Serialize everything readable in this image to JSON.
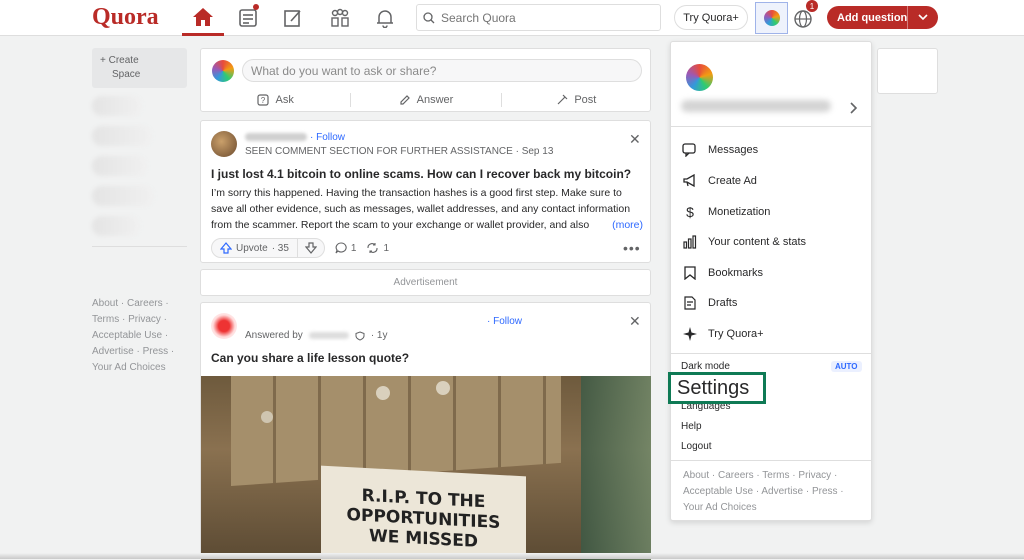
{
  "header": {
    "logo": "Quora",
    "search_placeholder": "Search Quora",
    "try_quora_plus": "Try Quora+",
    "notification_count": "1",
    "add_question": "Add question"
  },
  "sidebar": {
    "create_space_line1": "+ Create",
    "create_space_line2": "Space",
    "footer_lines": [
      "About · Careers ·",
      "Terms · Privacy ·",
      "Acceptable Use ·",
      "Advertise · Press ·",
      "Your Ad Choices"
    ]
  },
  "ask_box": {
    "placeholder": "What do you want to ask or share?",
    "ask": "Ask",
    "answer": "Answer",
    "post": "Post"
  },
  "post1": {
    "follow": "· Follow",
    "meta": "SEEN COMMENT SECTION FOR FURTHER ASSISTANCE · Sep 13",
    "title": "I just lost 4.1 bitcoin to online scams. How can I recover back my bitcoin?",
    "body_lines": [
      "I’m sorry this happened. Having the transaction hashes is a good first step. Make sure to",
      "save all other evidence, such as messages, wallet addresses, and any contact information",
      "from the scammer. Report the scam to your exchange or wallet provider, and also"
    ],
    "more": "(more)",
    "upvote": "Upvote",
    "upvote_count": "· 35",
    "comments": "1",
    "shares": "1"
  },
  "advertisement": "Advertisement",
  "post2": {
    "answered_by": "Answered by",
    "time": "· 1y",
    "follow": "· Follow",
    "title": "Can you share a life lesson quote?",
    "image_text_lines": [
      "R.I.P. TO THE",
      "OPPORTUNITIES",
      "WE MISSED"
    ]
  },
  "dropdown": {
    "items": [
      {
        "label": "Messages",
        "icon": "message-icon"
      },
      {
        "label": "Create Ad",
        "icon": "megaphone-icon"
      },
      {
        "label": "Monetization",
        "icon": "dollar-icon"
      },
      {
        "label": "Your content & stats",
        "icon": "bar-chart-icon"
      },
      {
        "label": "Bookmarks",
        "icon": "bookmark-icon"
      },
      {
        "label": "Drafts",
        "icon": "drafts-icon"
      },
      {
        "label": "Try Quora+",
        "icon": "sparkle-icon"
      }
    ],
    "dark_mode": "Dark mode",
    "dark_mode_value": "AUTO",
    "settings": "Settings",
    "languages": "Languages",
    "help": "Help",
    "logout": "Logout",
    "footer_lines": [
      "About · Careers · Terms · Privacy ·",
      "Acceptable Use · Advertise · Press ·",
      "Your Ad Choices"
    ]
  },
  "colors": {
    "brand": "#b92b27",
    "link": "#2e69ff",
    "highlight": "#0f7a55"
  }
}
